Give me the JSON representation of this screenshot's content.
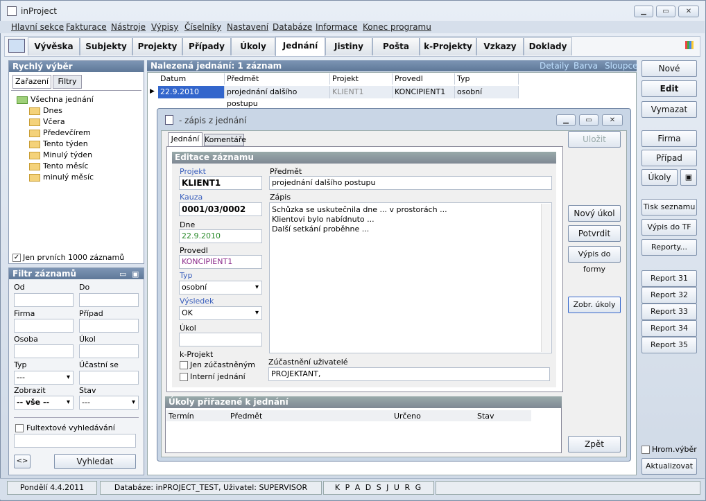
{
  "window": {
    "title": "inProject"
  },
  "menu": [
    "Hlavní sekce",
    "Fakturace",
    "Nástroje",
    "Výpisy",
    "Číselníky",
    "Nastavení",
    "Databáze",
    "Informace",
    "Konec programu"
  ],
  "tabs": [
    "Vývěska",
    "Subjekty",
    "Projekty",
    "Případy",
    "Úkoly",
    "Jednání",
    "Jistiny",
    "Pošta",
    "k-Projekty",
    "Vzkazy",
    "Doklady"
  ],
  "active_tab": "Jednání",
  "quick": {
    "title": "Rychlý výběr",
    "tab_zarazeni": "Zařazení",
    "tab_filtry": "Filtry",
    "root": "Všechna jednání",
    "items": [
      "Dnes",
      "Včera",
      "Předevčírem",
      "Tento týden",
      "Minulý týden",
      "Tento měsíc",
      "minulý měsíc"
    ],
    "limit_label": "Jen prvních 1000 záznamů",
    "limit_checked": "✓"
  },
  "filter": {
    "title": "Filtr záznamů",
    "od": "Od",
    "do": "Do",
    "firma": "Firma",
    "pripad": "Případ",
    "osoba": "Osoba",
    "ukol": "Úkol",
    "typ": "Typ",
    "ucastni": "Účastní se",
    "typ_value": "---",
    "zobrazit": "Zobrazit",
    "zobrazit_value": "-- vše --",
    "stav": "Stav",
    "stav_value": "---",
    "fulltext": "Fultextové vyhledávání",
    "expand": "<>",
    "search_btn": "Vyhledat"
  },
  "results": {
    "title": "Nalezená jednání: 1 záznam",
    "links": [
      "Detaily",
      "Barva",
      "Sloupce"
    ],
    "columns": [
      "Datum",
      "Předmět",
      "Projekt",
      "Provedl",
      "Typ"
    ],
    "rows": [
      [
        "22.9.2010",
        "projednání dalšího postupu",
        "KLIENT1",
        "KONCIPIENT1",
        "osobní"
      ]
    ]
  },
  "dialog": {
    "title": "- zápis z jednání",
    "tab_jednani": "Jednání",
    "tab_komentare": "Komentáře",
    "save": "Uložit",
    "section": "Editace záznamu",
    "projekt_label": "Projekt",
    "projekt": "KLIENT1",
    "kauza_label": "Kauza",
    "kauza": "0001/03/0002",
    "dne_label": "Dne",
    "dne": "22.9.2010",
    "provedl_label": "Provedl",
    "provedl": "KONCIPIENT1",
    "typ_label": "Typ",
    "typ": "osobní",
    "vysledek_label": "Výsledek",
    "vysledek": "OK",
    "ukol_label": "Úkol",
    "kprojekt_label": "k-Projekt",
    "jen_label": "Jen zúčastněným",
    "interni_label": "Interní jednání",
    "predmet_label": "Předmět",
    "predmet": "projednání dalšího postupu",
    "zapis_label": "Zápis",
    "zapis_lines": [
      "Schůzka se uskutečnila dne ... v prostorách ...",
      "Klientovi bylo nabídnuto ...",
      "Další setkání proběhne ..."
    ],
    "ucastneni_label": "Zúčastnění uživatelé",
    "ucastneni": "PROJEKTANT,",
    "btn_novy": "Nový úkol",
    "btn_potvrdit": "Potvrdit",
    "btn_vypis": "Výpis do formy",
    "btn_zobr": "Zobr. úkoly",
    "tasks_title": "Úkoly přiřazené k jednání",
    "task_cols": [
      "Termín",
      "Předmět",
      "Určeno",
      "Stav"
    ],
    "back": "Zpět"
  },
  "right": {
    "nove": "Nové",
    "edit": "Edit",
    "vymazat": "Vymazat",
    "firma": "Firma",
    "pripad": "Případ",
    "ukoly": "Úkoly",
    "tisk": "Tisk seznamu",
    "vypis_tf": "Výpis do TF",
    "reporty": "Reporty...",
    "reports": [
      "Report 31",
      "Report 32",
      "Report 33",
      "Report 34",
      "Report 35"
    ],
    "hrom": "Hrom.výběr",
    "aktualizovat": "Aktualizovat"
  },
  "status": {
    "date": "Pondělí 4.4.2011",
    "db": "Databáze: inPROJECT_TEST, Uživatel: SUPERVISOR",
    "keys": "K P A D S J U R G"
  }
}
